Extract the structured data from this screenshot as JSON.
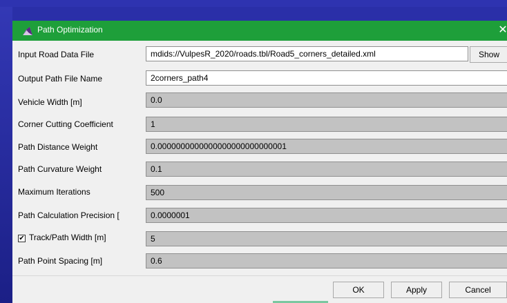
{
  "window": {
    "title": "Path Optimization",
    "close_glyph": "✕"
  },
  "rows": {
    "input_file": {
      "label": "Input Road Data File",
      "value": "mdids://VulpesR_2020/roads.tbl/Road5_corners_detailed.xml"
    },
    "output_name": {
      "label": "Output Path File Name",
      "value": "2corners_path4"
    },
    "vehicle_width": {
      "label": "Vehicle Width [m]",
      "value": "0.0"
    },
    "corner_cutting": {
      "label": "Corner Cutting Coefficient",
      "value": "1"
    },
    "distance_weight": {
      "label": "Path Distance Weight",
      "value": "0.0000000000000000000000000001"
    },
    "curvature_weight": {
      "label": "Path Curvature Weight",
      "value": "0.1"
    },
    "max_iterations": {
      "label": "Maximum Iterations",
      "value": "500"
    },
    "precision": {
      "label": "Path Calculation Precision [",
      "value": "0.0000001"
    },
    "track_width": {
      "label": "Track/Path Width [m]",
      "value": "5",
      "checked": true
    },
    "point_spacing": {
      "label": "Path Point Spacing [m]",
      "value": "0.6"
    }
  },
  "buttons": {
    "show": "Show",
    "ok": "OK",
    "apply": "Apply",
    "cancel": "Cancel"
  },
  "icons": {
    "app": "app-logo-icon",
    "close": "close-icon",
    "check": "✔"
  },
  "colors": {
    "titlebar": "#1e9f3a",
    "desktop": "#2a2fa8",
    "readonly_field": "#c2c2c2"
  }
}
